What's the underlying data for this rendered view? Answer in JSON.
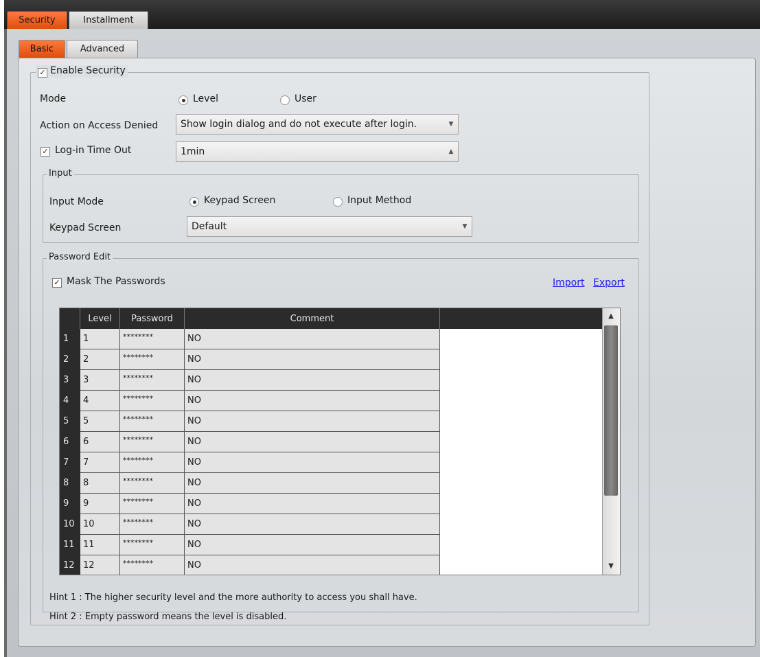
{
  "top_tabs": [
    {
      "label": "Security",
      "active": true
    },
    {
      "label": "Installment",
      "active": false
    }
  ],
  "sub_tabs": [
    {
      "label": "Basic",
      "active": true
    },
    {
      "label": "Advanced",
      "active": false
    }
  ],
  "enable_security": {
    "label": "Enable Security",
    "checked": true
  },
  "mode": {
    "label": "Mode",
    "options": [
      "Level",
      "User"
    ],
    "selected": "Level"
  },
  "action_denied": {
    "label": "Action on Access Denied",
    "value": "Show login dialog and do not execute after login."
  },
  "login_timeout": {
    "label": "Log-in Time Out",
    "checked": true,
    "value": "1min"
  },
  "input_group": {
    "legend": "Input",
    "mode_label": "Input Mode",
    "options": [
      "Keypad Screen",
      "Input Method"
    ],
    "selected": "Keypad Screen",
    "keypad_label": "Keypad Screen",
    "keypad_value": "Default"
  },
  "password_group": {
    "legend": "Password Edit",
    "mask_label": "Mask The Passwords",
    "mask_checked": true,
    "import_label": "Import",
    "export_label": "Export"
  },
  "table": {
    "columns": [
      "Level",
      "Password",
      "Comment"
    ],
    "rows": [
      {
        "num": "1",
        "level": "1",
        "password": "********",
        "comment": "NO"
      },
      {
        "num": "2",
        "level": "2",
        "password": "********",
        "comment": "NO"
      },
      {
        "num": "3",
        "level": "3",
        "password": "********",
        "comment": "NO"
      },
      {
        "num": "4",
        "level": "4",
        "password": "********",
        "comment": "NO"
      },
      {
        "num": "5",
        "level": "5",
        "password": "********",
        "comment": "NO"
      },
      {
        "num": "6",
        "level": "6",
        "password": "********",
        "comment": "NO"
      },
      {
        "num": "7",
        "level": "7",
        "password": "********",
        "comment": "NO"
      },
      {
        "num": "8",
        "level": "8",
        "password": "********",
        "comment": "NO"
      },
      {
        "num": "9",
        "level": "9",
        "password": "********",
        "comment": "NO"
      },
      {
        "num": "10",
        "level": "10",
        "password": "********",
        "comment": "NO"
      },
      {
        "num": "11",
        "level": "11",
        "password": "********",
        "comment": "NO"
      },
      {
        "num": "12",
        "level": "12",
        "password": "********",
        "comment": "NO"
      }
    ]
  },
  "hints": [
    "Hint 1 : The higher security level and the more authority to access you shall have.",
    "Hint 2 : Empty password means the level is disabled."
  ],
  "icons": {
    "check": "✓",
    "dropdown": "▼",
    "spin": "▲"
  }
}
